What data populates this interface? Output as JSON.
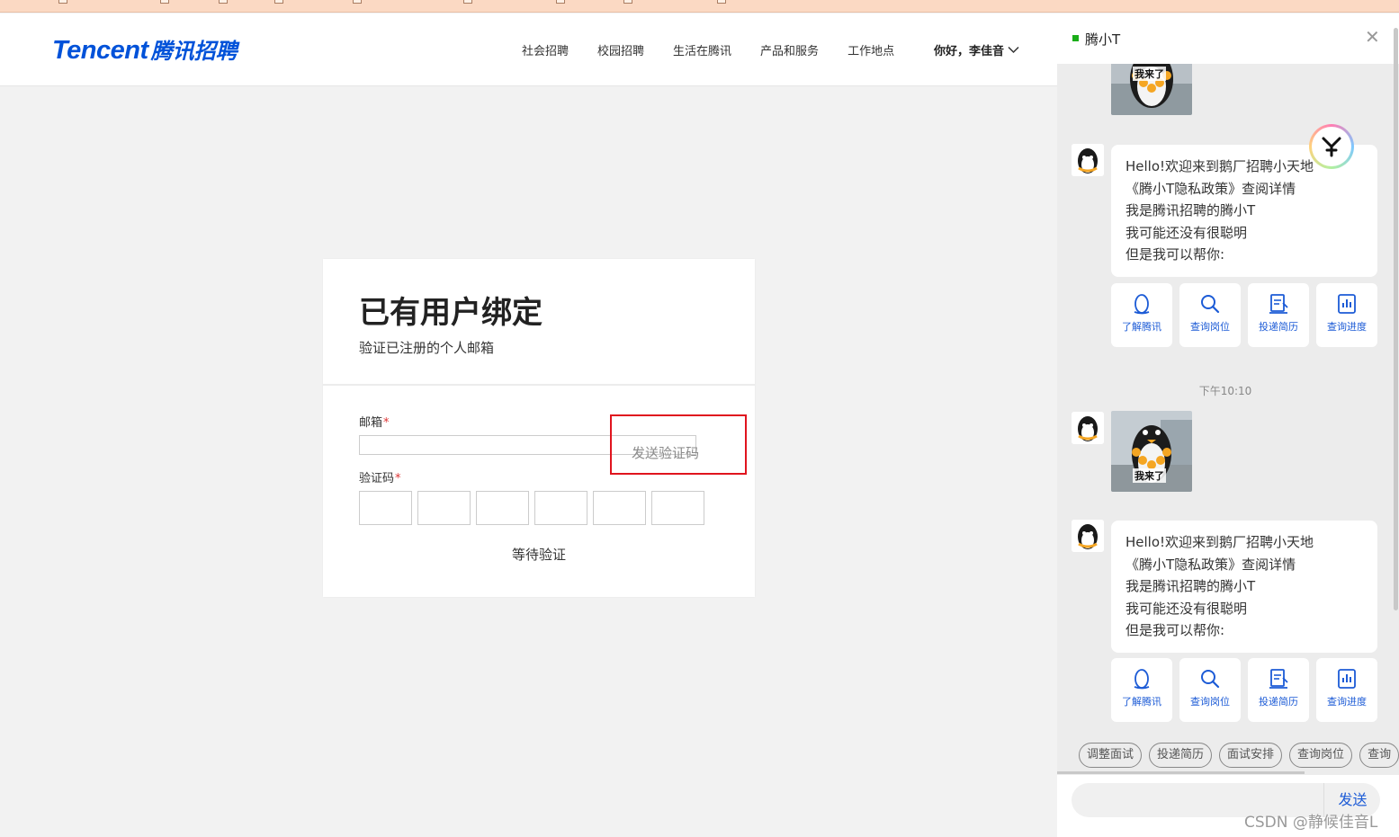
{
  "colors": {
    "brand": "#0052d9",
    "link_blue": "#1c5bd6",
    "highlight": "#e0141e",
    "online": "#1aad19"
  },
  "header": {
    "logo_en": "Tencent",
    "logo_cn": "腾讯招聘",
    "nav": [
      "社会招聘",
      "校园招聘",
      "生活在腾讯",
      "产品和服务",
      "工作地点"
    ],
    "user_greeting": "你好，李佳音",
    "user_menu_icon": "chevron-down-icon"
  },
  "form": {
    "title": "已有用户绑定",
    "subtitle": "验证已注册的个人邮箱",
    "email_label": "邮箱",
    "email_required": "*",
    "email_value": "",
    "send_code": "发送验证码",
    "code_label": "验证码",
    "code_required": "*",
    "code_digits": [
      "",
      "",
      "",
      "",
      "",
      ""
    ],
    "submit": "等待验证"
  },
  "chat": {
    "title": "腾小T",
    "close_icon": "close-icon",
    "sticker_text": "我来了",
    "greeting_lines": [
      "Hello!欢迎来到鹅厂招聘小天地",
      "《腾小T隐私政策》查阅详情",
      "我是腾讯招聘的腾小T",
      "我可能还没有很聪明",
      "但是我可以帮你:"
    ],
    "quick_actions": [
      {
        "label": "了解腾讯",
        "icon": "penguin-icon"
      },
      {
        "label": "查询岗位",
        "icon": "search-icon"
      },
      {
        "label": "投递简历",
        "icon": "resume-icon"
      },
      {
        "label": "查询进度",
        "icon": "progress-icon"
      }
    ],
    "timestamp": "下午10:10",
    "chips": [
      "调整面试",
      "投递简历",
      "面试安排",
      "查询岗位",
      "查询"
    ],
    "send_label": "发送"
  },
  "watermark": "CSDN @静候佳音L"
}
